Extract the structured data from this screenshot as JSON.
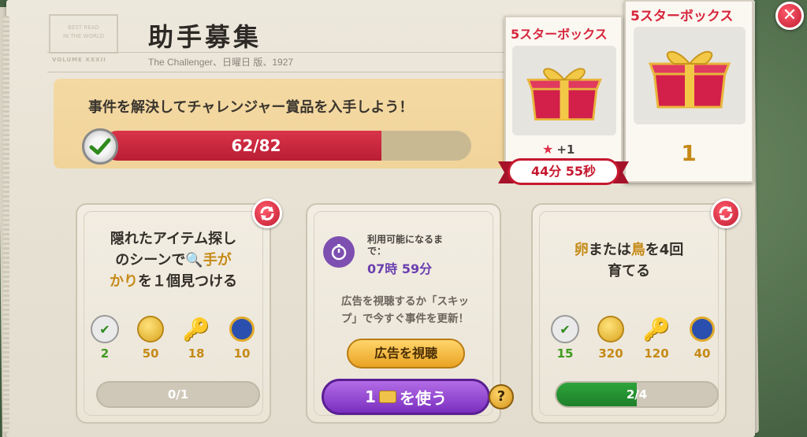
{
  "header": {
    "title": "助手募集",
    "subtitle": "The Challenger、日曜日 版、1927",
    "stamp_line1": "BEST READ",
    "stamp_line2": "IN THE WORLD",
    "masthead": "VOLUME XXXII"
  },
  "banner": {
    "text": "事件を解決してチャレンジャー賞品を入手しよう！",
    "progress_text": "62/82",
    "progress_current": 62,
    "progress_total": 82
  },
  "reward_boxes": {
    "current": {
      "title": "5スターボックス",
      "star_bonus": "+1",
      "timer": "44分 55秒"
    },
    "next": {
      "title": "5スターボックス",
      "count": "1"
    }
  },
  "task_left": {
    "line1": "隠れたアイテム探し",
    "line2_a": "のシーンで",
    "line2_b": "手が",
    "line3_a": "かり",
    "line3_b": "を１個見つける",
    "rewards": [
      "2",
      "50",
      "18",
      "10"
    ],
    "progress_text": "0/1",
    "progress_value": 0,
    "progress_max": 1
  },
  "task_middle": {
    "available_label_1": "利用可能になるま",
    "available_label_2": "で：",
    "available_time": "07時 59分",
    "ad_line1": "広告を視聴するか「スキッ",
    "ad_line2": "プ」で今すぐ事件を更新！",
    "watch_ad_label": "広告を視聴",
    "use_label_num": "1",
    "use_label_text": "を使う",
    "help_label": "?"
  },
  "task_right": {
    "line1_a": "卵",
    "line1_b": "または",
    "line1_c": "鳥",
    "line1_d": "を4回",
    "line2": "育てる",
    "rewards": [
      "15",
      "320",
      "120",
      "40"
    ],
    "progress_text": "2/4",
    "progress_value": 2,
    "progress_max": 4
  },
  "close_label": "✕"
}
